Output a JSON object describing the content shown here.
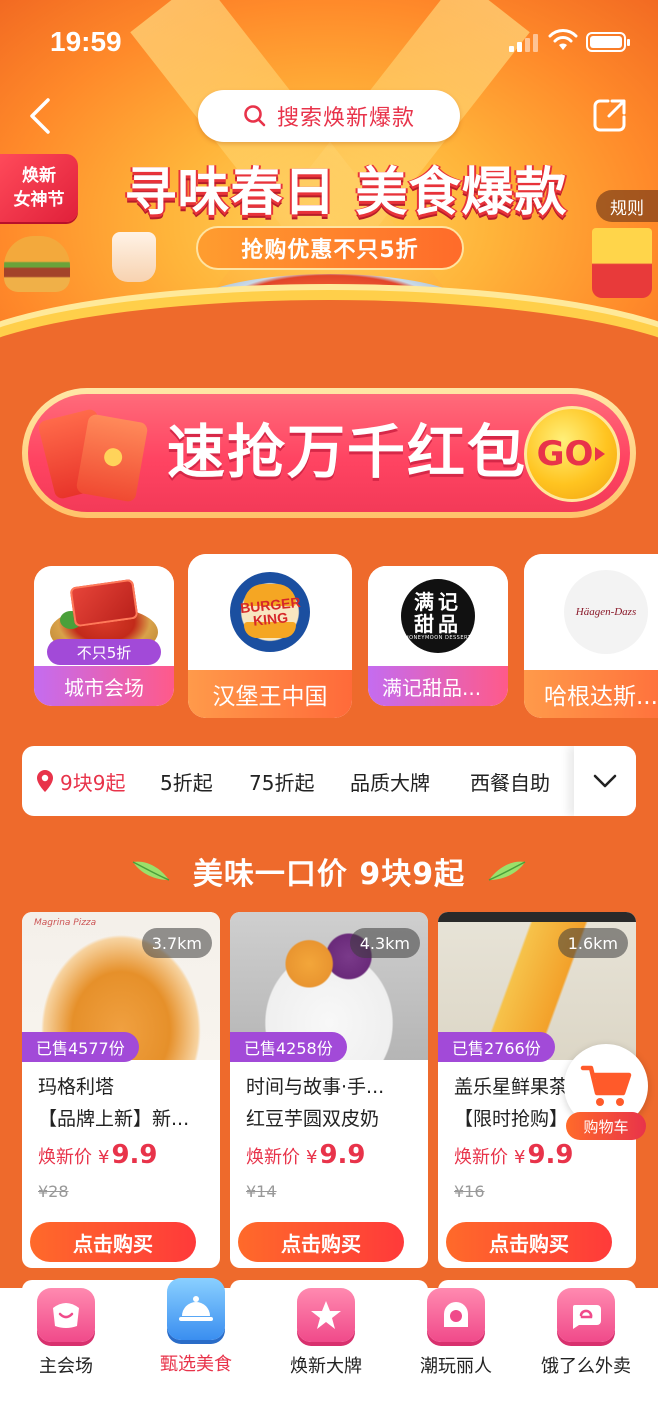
{
  "status_bar": {
    "time": "19:59"
  },
  "hero": {
    "search_placeholder": "搜索焕新爆款",
    "festival_badge_line1": "焕新",
    "festival_badge_line2": "女神节",
    "title": "寻味春日 美食爆款",
    "subtitle": "抢购优惠不只5折",
    "rules_label": "规则"
  },
  "red_packet": {
    "title": "速抢万千红包",
    "go_label": "GO"
  },
  "brands": [
    {
      "name": "城市会场",
      "tag": "不只5折"
    },
    {
      "name": "汉堡王中国",
      "logo_text_1": "BURGER",
      "logo_text_2": "KING"
    },
    {
      "name": "满记甜品...",
      "logo_text_1": "满记",
      "logo_text_2": "甜品",
      "logo_small": "HONEYMOON DESSERT"
    },
    {
      "name": "哈根达斯...",
      "logo_text": "Häagen-Dazs"
    }
  ],
  "filter": {
    "items": [
      "9块9起",
      "5折起",
      "75折起",
      "品质大牌",
      "西餐自助"
    ],
    "active_index": 0
  },
  "section": {
    "title": "美味一口价 9块9起"
  },
  "products": [
    {
      "distance": "3.7km",
      "sold": "已售4577份",
      "name_line1": "玛格利塔",
      "name_line2": "【品牌上新】新...",
      "price_label": "焕新价",
      "currency": "¥",
      "price": "9.9",
      "original_price": "¥28",
      "buy_label": "点击购买",
      "brand_script": "Magrina Pizza"
    },
    {
      "distance": "4.3km",
      "sold": "已售4258份",
      "name_line1": "时间与故事·手...",
      "name_line2": "红豆芋圆双皮奶",
      "price_label": "焕新价",
      "currency": "¥",
      "price": "9.9",
      "original_price": "¥14",
      "buy_label": "点击购买"
    },
    {
      "distance": "1.6km",
      "sold": "已售2766份",
      "name_line1": "盖乐星鲜果茶",
      "name_line2": "【限时抢购】",
      "price_label": "焕新价",
      "currency": "¥",
      "price": "9.9",
      "original_price": "¥16",
      "buy_label": "点击购买"
    }
  ],
  "cart": {
    "label": "购物车"
  },
  "tabs": [
    {
      "label": "主会场",
      "icon": "smile-bag-icon"
    },
    {
      "label": "甄选美食",
      "icon": "food-cloche-icon",
      "active": true
    },
    {
      "label": "焕新大牌",
      "icon": "star-icon"
    },
    {
      "label": "潮玩丽人",
      "icon": "beauty-icon"
    },
    {
      "label": "饿了么外卖",
      "icon": "eleme-icon"
    }
  ],
  "colors": {
    "page_bg": "#ee6a2c",
    "accent_red": "#e8334a",
    "purple_tag": "#a24ad8",
    "active_tab": "#3a8ef0"
  }
}
